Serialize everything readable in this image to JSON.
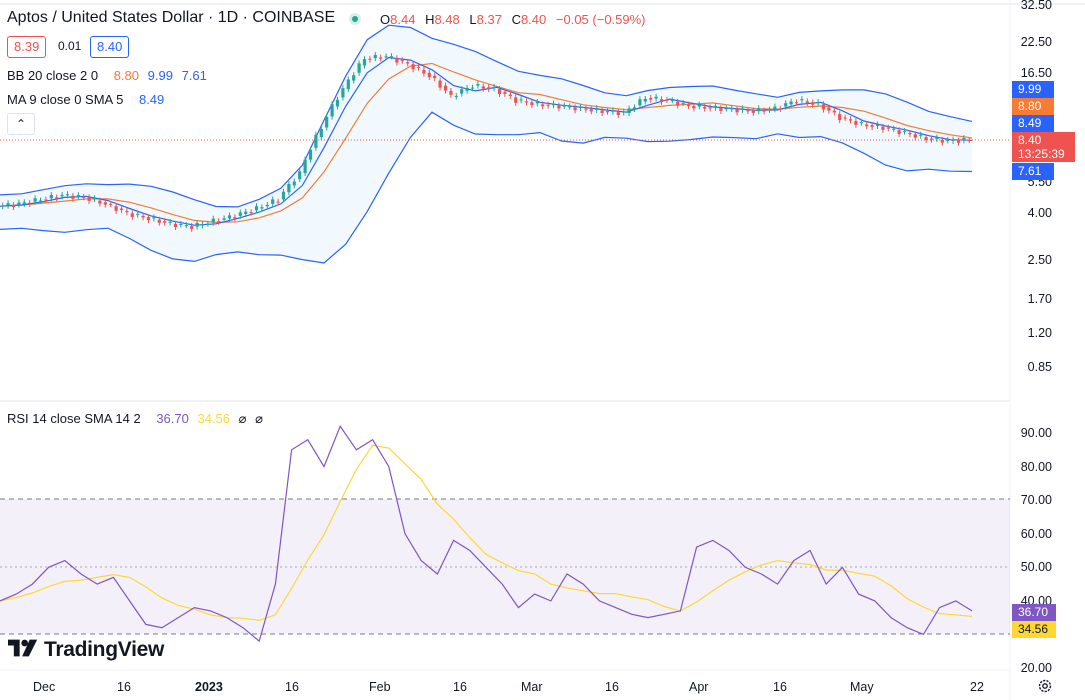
{
  "header": {
    "title": "Aptos / United States Dollar · 1D · COINBASE",
    "ohlc": [
      {
        "label": "O",
        "value": "8.44"
      },
      {
        "label": "H",
        "value": "8.48"
      },
      {
        "label": "L",
        "value": "8.37"
      },
      {
        "label": "C",
        "value": "8.40"
      }
    ],
    "change": "−0.05 (−0.59%)",
    "sell_price": "8.39",
    "spread": "0.01",
    "buy_price": "8.40",
    "collapse_symbol": "⌃"
  },
  "indicators": {
    "bb": {
      "label": "BB 20 close 2 0",
      "basis": "8.80",
      "upper": "9.99",
      "lower": "7.61"
    },
    "ma": {
      "label": "MA 9 close 0 SMA 5",
      "value": "8.49"
    },
    "rsi": {
      "label": "RSI 14 close SMA 14 2",
      "value": "36.70",
      "sma": "34.56",
      "extra1": "⌀",
      "extra2": "⌀"
    }
  },
  "price_axis": [
    "32.50",
    "22.50",
    "16.50",
    "5.50",
    "4.00",
    "2.50",
    "1.70",
    "1.20",
    "0.85"
  ],
  "price_tags": {
    "upper": "9.99",
    "basis": "8.80",
    "ma": "8.49",
    "last": "8.40",
    "countdown": "13:25:39",
    "lower": "7.61"
  },
  "rsi_axis": [
    "90.00",
    "80.00",
    "70.00",
    "60.00",
    "50.00",
    "40.00",
    "20.00"
  ],
  "rsi_tags": {
    "rsi": "36.70",
    "sma": "34.56"
  },
  "time_axis": [
    "Dec",
    "16",
    "2023",
    "16",
    "Feb",
    "16",
    "Mar",
    "16",
    "Apr",
    "16",
    "May",
    "22"
  ],
  "branding": "TradingView",
  "colors": {
    "up": "#26a69a",
    "down": "#ef5350",
    "bb_basis": "#f57c34",
    "bb_band": "#2962ff",
    "ma": "#2962ff",
    "rsi": "#7e57c2",
    "rsi_sma": "#fdd835"
  },
  "chart_data": [
    {
      "type": "candlestick",
      "title": "Aptos / United States Dollar · 1D · COINBASE",
      "scale": "log",
      "ylim": [
        0.7,
        32.5
      ],
      "x_ticks": [
        "Dec",
        "16",
        "2023",
        "16",
        "Feb",
        "16",
        "Mar",
        "16",
        "Apr",
        "16",
        "May",
        "22"
      ],
      "close_series_approx": {
        "dates": [
          "Nov 28",
          "Dec 1",
          "Dec 5",
          "Dec 9",
          "Dec 13",
          "Dec 17",
          "Dec 21",
          "Dec 25",
          "Dec 29",
          "Jan 2",
          "Jan 5",
          "Jan 8",
          "Jan 11",
          "Jan 14",
          "Jan 17",
          "Jan 20",
          "Jan 23",
          "Jan 26",
          "Jan 29",
          "Feb 1",
          "Feb 4",
          "Feb 8",
          "Feb 12",
          "Feb 16",
          "Feb 20",
          "Feb 24",
          "Feb 28",
          "Mar 4",
          "Mar 8",
          "Mar 12",
          "Mar 16",
          "Mar 20",
          "Mar 24",
          "Mar 28",
          "Apr 1",
          "Apr 5",
          "Apr 9",
          "Apr 13",
          "Apr 17",
          "Apr 21",
          "Apr 25",
          "Apr 29",
          "May 3",
          "May 7",
          "May 11",
          "May 14"
        ],
        "values": [
          4.3,
          4.4,
          4.6,
          4.8,
          4.7,
          4.4,
          4.0,
          3.8,
          3.6,
          3.5,
          3.7,
          3.9,
          4.2,
          4.6,
          6.0,
          9.5,
          14.0,
          19.0,
          19.5,
          18.0,
          16.0,
          13.0,
          14.5,
          14.0,
          12.5,
          12.0,
          11.8,
          11.5,
          11.2,
          11.0,
          12.8,
          12.5,
          11.8,
          11.6,
          11.4,
          11.2,
          11.5,
          12.5,
          12.0,
          10.5,
          9.8,
          9.5,
          9.0,
          8.5,
          8.3,
          8.4
        ]
      },
      "bollinger": {
        "period": 20,
        "basis": 8.8,
        "upper": 9.99,
        "lower": 7.61
      },
      "moving_average": {
        "period": 9,
        "value": 8.49
      },
      "last_price": 8.4
    },
    {
      "type": "line",
      "title": "RSI 14 close SMA 14 2",
      "ylim": [
        20,
        95
      ],
      "bands": [
        30,
        70
      ],
      "midline": 50,
      "series": [
        {
          "name": "RSI",
          "last": 36.7
        },
        {
          "name": "SMA",
          "last": 34.56
        }
      ],
      "rsi_series_approx": [
        40,
        42,
        45,
        50,
        52,
        48,
        45,
        47,
        40,
        33,
        32,
        35,
        38,
        37,
        35,
        32,
        28,
        45,
        85,
        88,
        80,
        92,
        85,
        88,
        80,
        60,
        52,
        48,
        58,
        55,
        50,
        45,
        38,
        42,
        40,
        48,
        45,
        40,
        38,
        36,
        35,
        36,
        37,
        56,
        58,
        55,
        50,
        48,
        45,
        52,
        55,
        45,
        50,
        42,
        40,
        35,
        32,
        30,
        38,
        40,
        37
      ]
    }
  ]
}
